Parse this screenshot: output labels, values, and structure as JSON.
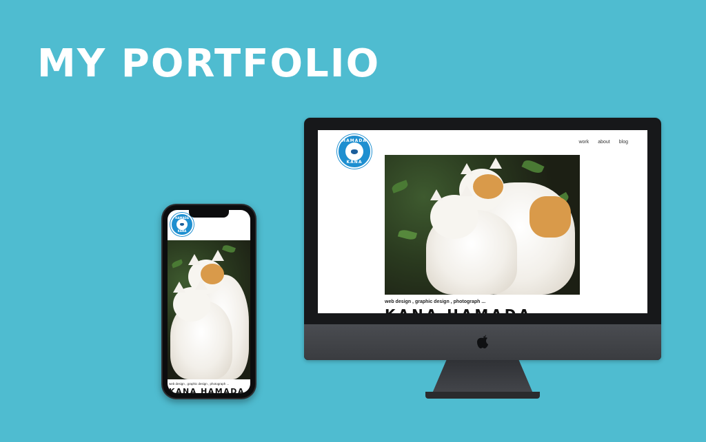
{
  "page": {
    "headline": "MY PORTFOLIO"
  },
  "logo": {
    "text_top": "HAMADA",
    "text_bottom": "KANA"
  },
  "nav": {
    "items": [
      "work",
      "about",
      "blog"
    ]
  },
  "site": {
    "tagline": "web design , graphic design , photograph ...",
    "name": "KANA HAMADA"
  },
  "colors": {
    "background": "#4fbcd0",
    "logo_blue": "#1e8fd0",
    "device_dark": "#17181a"
  },
  "icons": {
    "computer_brand": "apple-logo-icon"
  }
}
